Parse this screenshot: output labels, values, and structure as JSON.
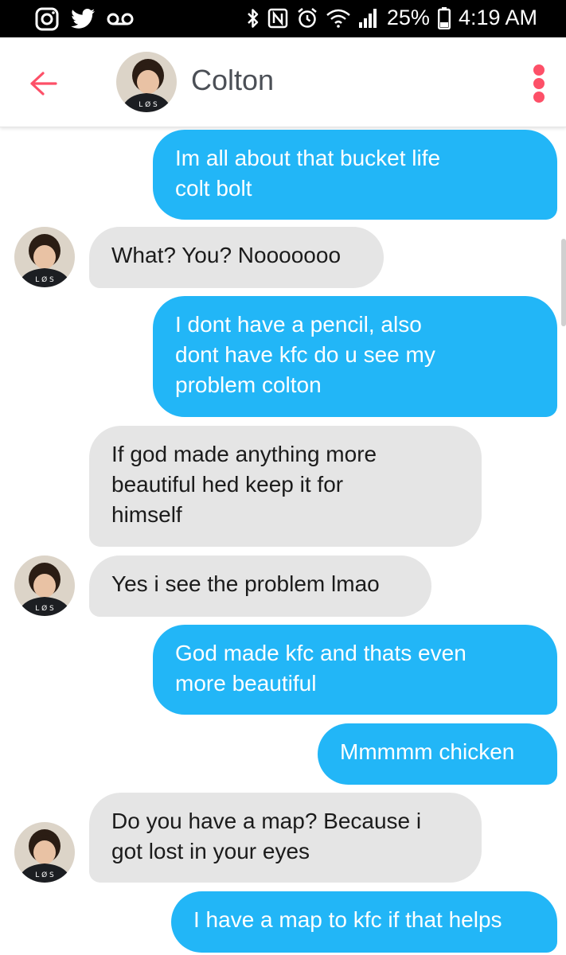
{
  "status_bar": {
    "battery_text": "25%",
    "time": "4:19 AM",
    "left_icons": [
      "instagram-icon",
      "twitter-icon",
      "voicemail-icon"
    ],
    "right_icons": [
      "bluetooth-icon",
      "nfc-icon",
      "alarm-icon",
      "wifi-icon",
      "signal-icon",
      "battery-icon"
    ]
  },
  "header": {
    "name": "Colton",
    "back_icon": "back-arrow-icon",
    "menu_icon": "more-vert-icon"
  },
  "colors": {
    "accent": "#fd5068",
    "outgoing_bubble": "#22b6f7",
    "incoming_bubble": "#e5e5e5"
  },
  "messages": [
    {
      "direction": "outgoing",
      "text": "Im all about that bucket life\ncolt bolt"
    },
    {
      "direction": "incoming",
      "text": "What? You? Nooooooo"
    },
    {
      "direction": "outgoing",
      "text": "I dont have a pencil, also\ndont have kfc do u see my\nproblem colton"
    },
    {
      "direction": "incoming",
      "text": "If god made anything more\nbeautiful hed keep it for\nhimself"
    },
    {
      "direction": "incoming",
      "text": "Yes i see the problem lmao"
    },
    {
      "direction": "outgoing",
      "text": "God made kfc and thats even\nmore beautiful"
    },
    {
      "direction": "outgoing",
      "text": "Mmmmm chicken"
    },
    {
      "direction": "incoming",
      "text": "Do you have a map? Because i\ngot lost in your eyes"
    },
    {
      "direction": "outgoing",
      "text": "I have a map to kfc if that helps"
    }
  ]
}
